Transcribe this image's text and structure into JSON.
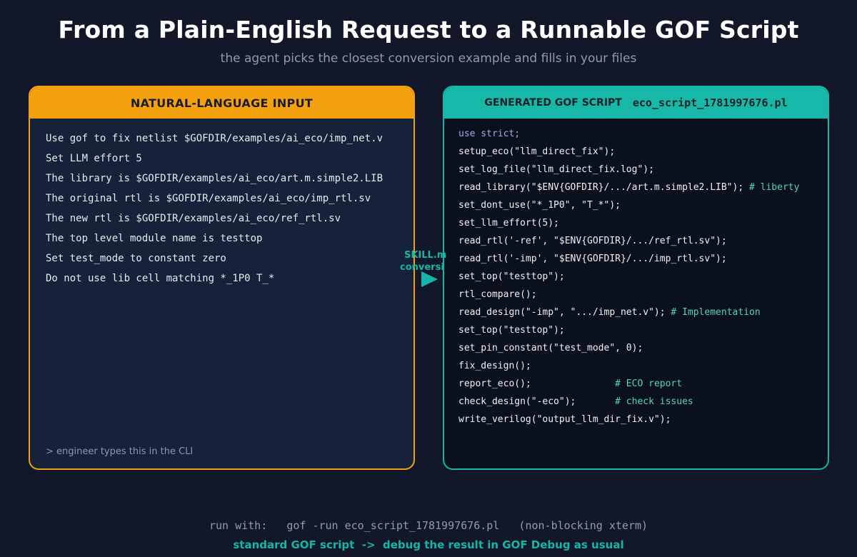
{
  "title": "From a Plain-English Request to a Runnable GOF Script",
  "subtitle": "the agent picks the closest conversion example and fills in your files",
  "input_panel": {
    "header": "NATURAL-LANGUAGE INPUT",
    "lines": [
      "Use gof to fix netlist $GOFDIR/examples/ai_eco/imp_net.v",
      "Set LLM effort 5",
      "The library is $GOFDIR/examples/ai_eco/art.m.simple2.LIB",
      "The original rtl is $GOFDIR/examples/ai_eco/imp_rtl.sv",
      "The new rtl is $GOFDIR/examples/ai_eco/ref_rtl.sv",
      "The top level module name is testtop",
      "Set test_mode to constant zero",
      "Do not use lib cell matching *_1P0 T_*"
    ],
    "footnote": "> engineer types this in the CLI"
  },
  "connector": {
    "line1": "SKILL.m",
    "line2": "conversi"
  },
  "script_panel": {
    "header_label": "GENERATED GOF SCRIPT",
    "header_file": "eco_script_1781997676.pl",
    "lines": [
      {
        "code": "use strict;",
        "comment": "",
        "keyword": true
      },
      {
        "code": "setup_eco(\"llm_direct_fix\");",
        "comment": ""
      },
      {
        "code": "set_log_file(\"llm_direct_fix.log\");",
        "comment": ""
      },
      {
        "code": "read_library(\"$ENV{GOFDIR}/.../art.m.simple2.LIB\"); ",
        "comment": "# liberty"
      },
      {
        "code": "set_dont_use(\"*_1P0\", \"T_*\");",
        "comment": ""
      },
      {
        "code": "set_llm_effort(5);",
        "comment": ""
      },
      {
        "code": "read_rtl('-ref', \"$ENV{GOFDIR}/.../ref_rtl.sv\");",
        "comment": ""
      },
      {
        "code": "read_rtl('-imp', \"$ENV{GOFDIR}/.../imp_rtl.sv\");",
        "comment": ""
      },
      {
        "code": "set_top(\"testtop\");",
        "comment": ""
      },
      {
        "code": "rtl_compare();",
        "comment": ""
      },
      {
        "code": "read_design(\"-imp\", \".../imp_net.v\"); ",
        "comment": "# Implementation"
      },
      {
        "code": "set_top(\"testtop\");",
        "comment": ""
      },
      {
        "code": "set_pin_constant(\"test_mode\", 0);",
        "comment": ""
      },
      {
        "code": "fix_design();",
        "comment": ""
      },
      {
        "code": "report_eco();               ",
        "comment": "# ECO report"
      },
      {
        "code": "check_design(\"-eco\");       ",
        "comment": "# check issues"
      },
      {
        "code": "write_verilog(\"output_llm_dir_fix.v\");",
        "comment": ""
      }
    ]
  },
  "footer": {
    "run_line": "run with:   gof -run eco_script_1781997676.pl   (non-blocking xterm)",
    "standard_line": "standard GOF script  ->  debug the result in GOF Debug as usual"
  },
  "colors": {
    "background": "#121829",
    "input_accent": "#f3a10f",
    "script_accent": "#17b8a7",
    "keyword": "#a9a3f0",
    "comment": "#4fd4c0"
  }
}
